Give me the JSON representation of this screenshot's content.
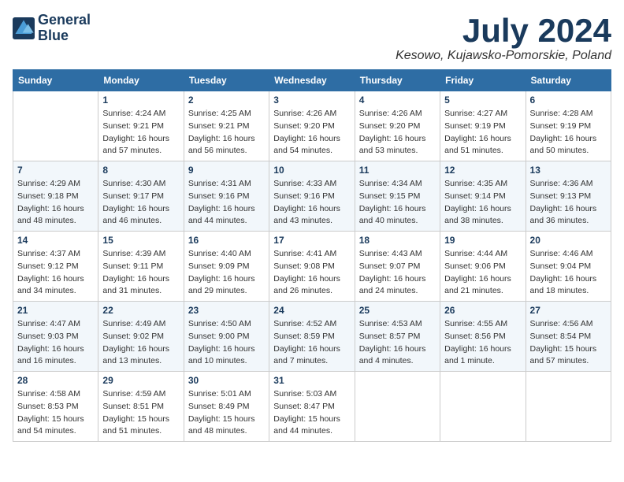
{
  "header": {
    "logo_line1": "General",
    "logo_line2": "Blue",
    "month": "July 2024",
    "location": "Kesowo, Kujawsko-Pomorskie, Poland"
  },
  "days_of_week": [
    "Sunday",
    "Monday",
    "Tuesday",
    "Wednesday",
    "Thursday",
    "Friday",
    "Saturday"
  ],
  "weeks": [
    [
      {
        "day": "",
        "info": ""
      },
      {
        "day": "1",
        "info": "Sunrise: 4:24 AM\nSunset: 9:21 PM\nDaylight: 16 hours\nand 57 minutes."
      },
      {
        "day": "2",
        "info": "Sunrise: 4:25 AM\nSunset: 9:21 PM\nDaylight: 16 hours\nand 56 minutes."
      },
      {
        "day": "3",
        "info": "Sunrise: 4:26 AM\nSunset: 9:20 PM\nDaylight: 16 hours\nand 54 minutes."
      },
      {
        "day": "4",
        "info": "Sunrise: 4:26 AM\nSunset: 9:20 PM\nDaylight: 16 hours\nand 53 minutes."
      },
      {
        "day": "5",
        "info": "Sunrise: 4:27 AM\nSunset: 9:19 PM\nDaylight: 16 hours\nand 51 minutes."
      },
      {
        "day": "6",
        "info": "Sunrise: 4:28 AM\nSunset: 9:19 PM\nDaylight: 16 hours\nand 50 minutes."
      }
    ],
    [
      {
        "day": "7",
        "info": "Sunrise: 4:29 AM\nSunset: 9:18 PM\nDaylight: 16 hours\nand 48 minutes."
      },
      {
        "day": "8",
        "info": "Sunrise: 4:30 AM\nSunset: 9:17 PM\nDaylight: 16 hours\nand 46 minutes."
      },
      {
        "day": "9",
        "info": "Sunrise: 4:31 AM\nSunset: 9:16 PM\nDaylight: 16 hours\nand 44 minutes."
      },
      {
        "day": "10",
        "info": "Sunrise: 4:33 AM\nSunset: 9:16 PM\nDaylight: 16 hours\nand 43 minutes."
      },
      {
        "day": "11",
        "info": "Sunrise: 4:34 AM\nSunset: 9:15 PM\nDaylight: 16 hours\nand 40 minutes."
      },
      {
        "day": "12",
        "info": "Sunrise: 4:35 AM\nSunset: 9:14 PM\nDaylight: 16 hours\nand 38 minutes."
      },
      {
        "day": "13",
        "info": "Sunrise: 4:36 AM\nSunset: 9:13 PM\nDaylight: 16 hours\nand 36 minutes."
      }
    ],
    [
      {
        "day": "14",
        "info": "Sunrise: 4:37 AM\nSunset: 9:12 PM\nDaylight: 16 hours\nand 34 minutes."
      },
      {
        "day": "15",
        "info": "Sunrise: 4:39 AM\nSunset: 9:11 PM\nDaylight: 16 hours\nand 31 minutes."
      },
      {
        "day": "16",
        "info": "Sunrise: 4:40 AM\nSunset: 9:09 PM\nDaylight: 16 hours\nand 29 minutes."
      },
      {
        "day": "17",
        "info": "Sunrise: 4:41 AM\nSunset: 9:08 PM\nDaylight: 16 hours\nand 26 minutes."
      },
      {
        "day": "18",
        "info": "Sunrise: 4:43 AM\nSunset: 9:07 PM\nDaylight: 16 hours\nand 24 minutes."
      },
      {
        "day": "19",
        "info": "Sunrise: 4:44 AM\nSunset: 9:06 PM\nDaylight: 16 hours\nand 21 minutes."
      },
      {
        "day": "20",
        "info": "Sunrise: 4:46 AM\nSunset: 9:04 PM\nDaylight: 16 hours\nand 18 minutes."
      }
    ],
    [
      {
        "day": "21",
        "info": "Sunrise: 4:47 AM\nSunset: 9:03 PM\nDaylight: 16 hours\nand 16 minutes."
      },
      {
        "day": "22",
        "info": "Sunrise: 4:49 AM\nSunset: 9:02 PM\nDaylight: 16 hours\nand 13 minutes."
      },
      {
        "day": "23",
        "info": "Sunrise: 4:50 AM\nSunset: 9:00 PM\nDaylight: 16 hours\nand 10 minutes."
      },
      {
        "day": "24",
        "info": "Sunrise: 4:52 AM\nSunset: 8:59 PM\nDaylight: 16 hours\nand 7 minutes."
      },
      {
        "day": "25",
        "info": "Sunrise: 4:53 AM\nSunset: 8:57 PM\nDaylight: 16 hours\nand 4 minutes."
      },
      {
        "day": "26",
        "info": "Sunrise: 4:55 AM\nSunset: 8:56 PM\nDaylight: 16 hours\nand 1 minute."
      },
      {
        "day": "27",
        "info": "Sunrise: 4:56 AM\nSunset: 8:54 PM\nDaylight: 15 hours\nand 57 minutes."
      }
    ],
    [
      {
        "day": "28",
        "info": "Sunrise: 4:58 AM\nSunset: 8:53 PM\nDaylight: 15 hours\nand 54 minutes."
      },
      {
        "day": "29",
        "info": "Sunrise: 4:59 AM\nSunset: 8:51 PM\nDaylight: 15 hours\nand 51 minutes."
      },
      {
        "day": "30",
        "info": "Sunrise: 5:01 AM\nSunset: 8:49 PM\nDaylight: 15 hours\nand 48 minutes."
      },
      {
        "day": "31",
        "info": "Sunrise: 5:03 AM\nSunset: 8:47 PM\nDaylight: 15 hours\nand 44 minutes."
      },
      {
        "day": "",
        "info": ""
      },
      {
        "day": "",
        "info": ""
      },
      {
        "day": "",
        "info": ""
      }
    ]
  ]
}
